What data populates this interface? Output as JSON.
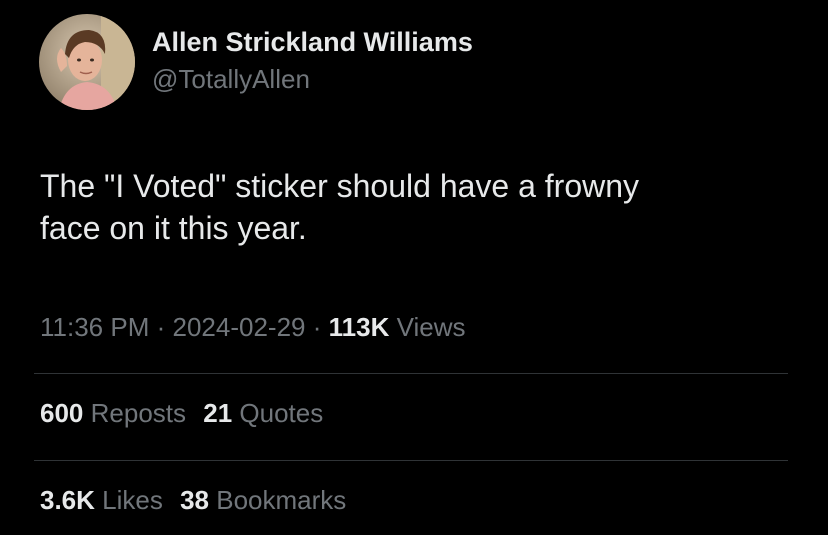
{
  "author": {
    "display_name": "Allen Strickland Williams",
    "handle": "@TotallyAllen",
    "avatar_icon": "profile-photo"
  },
  "tweet": {
    "text_line1": "The \"I Voted\" sticker should have a frowny",
    "text_line2": "face on it this year."
  },
  "meta": {
    "time": "11:36 PM",
    "separator": "·",
    "date": "2024-02-29",
    "views_count": "113K",
    "views_label": "Views"
  },
  "stats_row1": {
    "reposts_count": "600",
    "reposts_label": "Reposts",
    "quotes_count": "21",
    "quotes_label": "Quotes"
  },
  "stats_row2": {
    "likes_count": "3.6K",
    "likes_label": "Likes",
    "bookmarks_count": "38",
    "bookmarks_label": "Bookmarks"
  },
  "colors": {
    "background": "#000000",
    "primary_text": "#e7e9ea",
    "secondary_text": "#71767b",
    "divider": "#2f3336"
  }
}
